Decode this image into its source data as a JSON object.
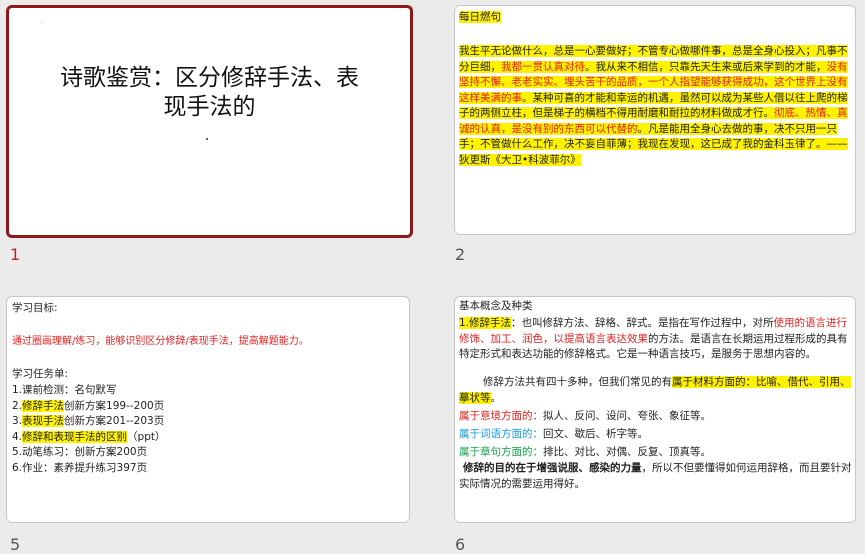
{
  "slides": [
    {
      "number": "1",
      "title_line1": "诗歌鉴赏：区分修辞手法、表",
      "title_line2": "现手法的"
    },
    {
      "number": "2",
      "heading": "每日燃句",
      "para": [
        {
          "t": "我生平无论做什么，总是一心要做好；不管专心做哪件事，总是全身心投入；",
          "c": ""
        },
        {
          "t": "凡事不分巨细，",
          "c": ""
        },
        {
          "t": "我都一贯认真对待",
          "c": "red"
        },
        {
          "t": "。我从来不相信，只靠先天生来或后来学到的才能，",
          "c": ""
        },
        {
          "t": "没有坚持不懈、老老实实、埋头苦干的品质，一个人指望能够获得成功，这个世界上没有这样美满的事",
          "c": "red"
        },
        {
          "t": "。某种可喜的才能和幸运的机遇，虽然可以成为某些人借以往上爬的梯子的两侧立柱，但是梯子的横档不得用耐磨和耐拉的材料做成才行。",
          "c": ""
        },
        {
          "t": "彻底、热情、真诚的认真，是没有别的东西可以代替的",
          "c": "red"
        },
        {
          "t": "。凡是能用全身心去做的事，决不只用一只手；不管做什么工作，决不妄自菲薄；我现在发现，这已成了我的金科玉律了。——狄更斯《大卫•科波菲尔》",
          "c": ""
        }
      ]
    },
    {
      "number": "5",
      "heading": "学习目标:",
      "goal": "通过圈画理解/练习，能够识别区分修辞/表现手法，提高解题能力。",
      "tasks_heading": "学习任务单:",
      "tasks": [
        {
          "pre": "1.",
          "hl": "课前检测",
          "post": "：名句默写",
          "mark": false
        },
        {
          "pre": "2.",
          "hl": "修辞手法",
          "post": "创新方案199--200页",
          "mark": true
        },
        {
          "pre": "3.",
          "hl": "表现手法",
          "post": "创新方案201--203页",
          "mark": true
        },
        {
          "pre": "4.",
          "hl": "修辞和表现手法的区别",
          "post": "（ppt）",
          "mark": true
        },
        {
          "pre": "5.",
          "hl": "动笔练习",
          "post": "：创新方案200页",
          "mark": false
        },
        {
          "pre": "6.",
          "hl": "作业",
          "post": "：素养提升练习397页",
          "mark": false
        }
      ]
    },
    {
      "number": "6",
      "heading": "基本概念及种类",
      "def_label": "1.修辞手法",
      "def_a": "：也叫修辞方法、辞格、辞式。是指在写作过程中，对所",
      "def_red": "使用的语言进行修饰、加工、润色，以提高语言表达效果",
      "def_b": "的方法。是语言在长期运用过程形成的具有特定形式和表达功能的修辞格式。它是一种语言技巧，是服务于思想内容的。",
      "common_a": "修辞方法共有四十多种，但我们常见的有",
      "common_hl": "属于材料方面的：比喻、借代、引用、摹状等",
      "common_b": "。",
      "groups": [
        {
          "label": "属于意境方面的：",
          "items": "拟人、反问、设问、夸张、象征等。",
          "color": "red"
        },
        {
          "label": "属于词语方面的：",
          "items": "回文、歇后、析字等。",
          "color": "blue"
        },
        {
          "label": "属于章句方面的：",
          "items": "排比、对比、对偶、反复、顶真等。",
          "color": "green"
        }
      ],
      "purpose_bold": "修辞的目的在于增强说服、感染的力量",
      "purpose_rest": "，所以不但要懂得如何运用辞格，而且要针对实际情况的需要运用得好。"
    }
  ]
}
